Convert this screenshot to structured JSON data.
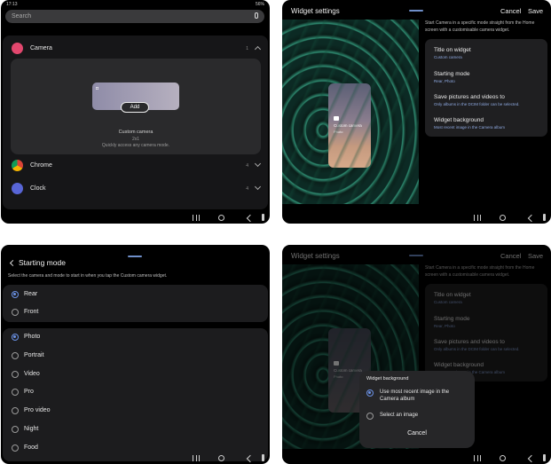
{
  "screen1": {
    "status": {
      "time": "17:13",
      "right": "56%"
    },
    "search_placeholder": "Search",
    "apps": [
      {
        "name": "Camera",
        "count": "1"
      },
      {
        "name": "Chrome",
        "count": "4"
      },
      {
        "name": "Clock",
        "count": "4"
      }
    ],
    "widget": {
      "add_label": "Add",
      "title": "Custom camera",
      "size": "2x1",
      "description": "Quickly access any camera mode."
    }
  },
  "screen2": {
    "title": "Widget settings",
    "cancel": "Cancel",
    "save": "Save",
    "intro": "Start Camera in a specific mode straight from the Home screen with a customisable camera widget.",
    "preview": {
      "title": "Custom camera",
      "subtitle": "Photo"
    },
    "settings": [
      {
        "title": "Title on widget",
        "value": "Custom camera"
      },
      {
        "title": "Starting mode",
        "value": "Rear, Photo"
      },
      {
        "title": "Save pictures and videos to",
        "value": "Only albums in the DCIM folder can be selected."
      },
      {
        "title": "Widget background",
        "value": "Most recent image in the Camera album"
      }
    ]
  },
  "screen3": {
    "title": "Starting mode",
    "description": "Select the camera and mode to start in when you tap the Custom camera widget.",
    "cameras": [
      {
        "label": "Rear",
        "selected": true
      },
      {
        "label": "Front",
        "selected": false
      }
    ],
    "modes": [
      {
        "label": "Photo",
        "selected": true
      },
      {
        "label": "Portrait",
        "selected": false
      },
      {
        "label": "Video",
        "selected": false
      },
      {
        "label": "Pro",
        "selected": false
      },
      {
        "label": "Pro video",
        "selected": false
      },
      {
        "label": "Night",
        "selected": false
      },
      {
        "label": "Food",
        "selected": false
      }
    ]
  },
  "screen4": {
    "dialog": {
      "title": "Widget background",
      "options": [
        {
          "label": "Use most recent image in the Camera album",
          "selected": true
        },
        {
          "label": "Select an image",
          "selected": false
        }
      ],
      "cancel": "Cancel"
    }
  }
}
